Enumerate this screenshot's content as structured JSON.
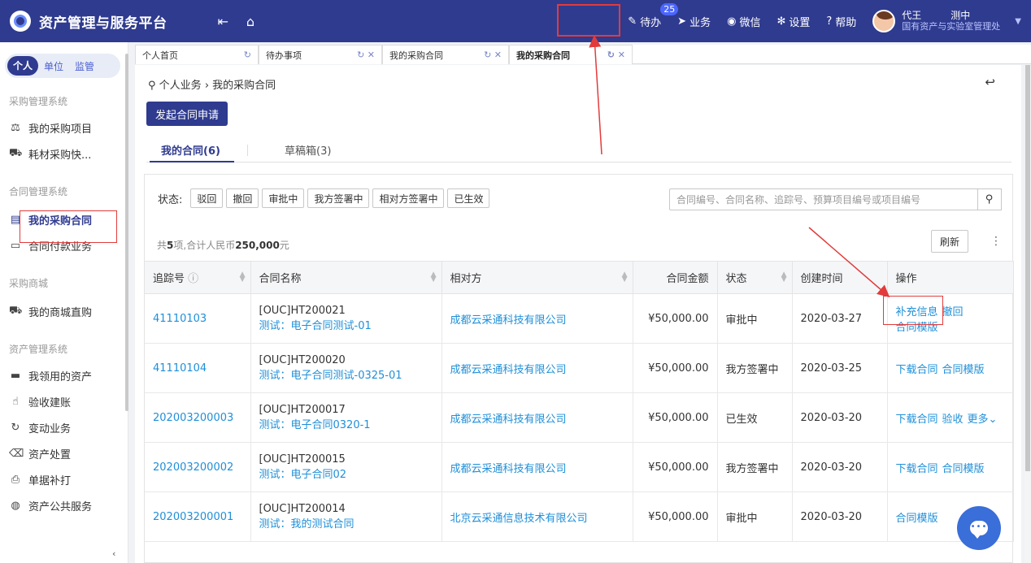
{
  "app": {
    "title": "资产管理与服务平台"
  },
  "topbar": {
    "todo": {
      "label": "待办",
      "badge": "25"
    },
    "business": "业务",
    "wechat": "微信",
    "settings": "设置",
    "help": "帮助",
    "user": {
      "name": "代王　　　测中",
      "dept": "国有资产与实验室管理处"
    }
  },
  "sidebar": {
    "tabs": [
      "个人",
      "单位",
      "监管"
    ],
    "groups": [
      {
        "title": "采购管理系统",
        "items": [
          "我的采购项目",
          "耗材采购快..."
        ]
      },
      {
        "title": "合同管理系统",
        "items": [
          "我的采购合同",
          "合同付款业务"
        ]
      },
      {
        "title": "采购商城",
        "items": [
          "我的商城直购"
        ]
      },
      {
        "title": "资产管理系统",
        "items": [
          "我领用的资产",
          "验收建账",
          "变动业务",
          "资产处置",
          "单据补打",
          "资产公共服务"
        ]
      }
    ],
    "collapse_arrow": "‹"
  },
  "page_tabs": [
    {
      "label": "个人首页"
    },
    {
      "label": "待办事项"
    },
    {
      "label": "我的采购合同"
    },
    {
      "label": "我的采购合同"
    }
  ],
  "breadcrumb": {
    "root": "个人业务",
    "sep": "›",
    "current": "我的采购合同"
  },
  "launch_button": "发起合同申请",
  "subtabs": {
    "mine": "我的合同(6)",
    "draft": "草稿箱(3)"
  },
  "filters": {
    "label": "状态:",
    "options": [
      "驳回",
      "撤回",
      "审批中",
      "我方签署中",
      "相对方签署中",
      "已生效"
    ]
  },
  "search": {
    "placeholder": "合同编号、合同名称、追踪号、预算项目编号或项目编号"
  },
  "summary": {
    "prefix": "共",
    "count": "5",
    "mid": "项,合计人民币",
    "amount": "250,000",
    "suffix": "元"
  },
  "refresh": "刷新",
  "table": {
    "headers": [
      "追踪号",
      "合同名称",
      "相对方",
      "合同金额",
      "状态",
      "创建时间",
      "操作"
    ],
    "rows": [
      {
        "track": "41110103",
        "code": "[OUC]HT200021",
        "name": "测试：电子合同测试-01",
        "party": "成都云采通科技有限公司",
        "amount": "¥50,000.00",
        "status": "审批中",
        "created": "2020-03-27",
        "ops": [
          "补充信息",
          "撤回",
          "合同模版"
        ]
      },
      {
        "track": "41110104",
        "code": "[OUC]HT200020",
        "name": "测试：电子合同测试-0325-01",
        "party": "成都云采通科技有限公司",
        "amount": "¥50,000.00",
        "status": "我方签署中",
        "created": "2020-03-25",
        "ops": [
          "下载合同",
          "合同模版"
        ]
      },
      {
        "track": "202003200003",
        "code": "[OUC]HT200017",
        "name": "测试：电子合同0320-1",
        "party": "成都云采通科技有限公司",
        "amount": "¥50,000.00",
        "status": "已生效",
        "created": "2020-03-20",
        "ops": [
          "下载合同",
          "验收",
          "更多⌄"
        ]
      },
      {
        "track": "202003200002",
        "code": "[OUC]HT200015",
        "name": "测试：电子合同02",
        "party": "成都云采通科技有限公司",
        "amount": "¥50,000.00",
        "status": "我方签署中",
        "created": "2020-03-20",
        "ops": [
          "下载合同",
          "合同模版"
        ]
      },
      {
        "track": "202003200001",
        "code": "[OUC]HT200014",
        "name": "测试：我的测试合同",
        "party": "北京云采通信息技术有限公司",
        "amount": "¥50,000.00",
        "status": "审批中",
        "created": "2020-03-20",
        "ops": [
          "合同模版"
        ]
      }
    ]
  },
  "colors": {
    "primary": "#2f3b8f",
    "link": "#1f8fd8",
    "annotation": "#e23b3b"
  }
}
